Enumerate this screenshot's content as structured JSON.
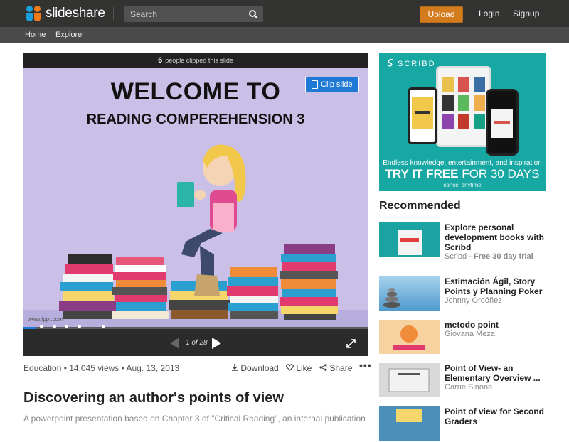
{
  "header": {
    "logo_text": "slideshare",
    "search_placeholder": "Search",
    "upload_label": "Upload",
    "login_label": "Login",
    "signup_label": "Signup"
  },
  "subnav": {
    "home": "Home",
    "explore": "Explore"
  },
  "player": {
    "clip_count": "6",
    "clip_text": "people clipped this slide",
    "clip_button": "Clip slide",
    "slide_title": "WELCOME TO",
    "slide_subtitle": "READING COMPEREHENSION 3",
    "slide_url": "www.fppt.com",
    "page_indicator": "1 of 28",
    "progress": 0.036
  },
  "meta": {
    "info": "Education • 14,045 views • Aug. 13, 2013",
    "download": "Download",
    "like": "Like",
    "share": "Share",
    "more": "•••"
  },
  "page_title": "Discovering an author's points of view",
  "description": "A powerpoint presentation based on Chapter 3 of \"Critical Reading\", an internal publication of",
  "ad": {
    "brand": "SCRIBD",
    "line1": "Endless knowledge, entertainment, and inspiration",
    "line2_bold": "TRY IT FREE",
    "line2_rest": " FOR 30 DAYS",
    "line3": "cancel anytime"
  },
  "recommended": {
    "heading": "Recommended",
    "items": [
      {
        "title": "Explore personal development books with Scribd",
        "author": "Scribd",
        "author_suffix": " - Free 30 day trial"
      },
      {
        "title": "Estimación Ágil, Story Points y Planning Poker",
        "author": "Johnny Ordóñez",
        "author_suffix": ""
      },
      {
        "title": "metodo point",
        "author": "Giovana Meza",
        "author_suffix": ""
      },
      {
        "title": "Point of View- an Elementary Overview ...",
        "author": "Carrie Sinone",
        "author_suffix": ""
      },
      {
        "title": "Point of view for Second Graders",
        "author": "",
        "author_suffix": ""
      }
    ]
  },
  "colors": {
    "accent": "#1e7ad4",
    "upload": "#d27c1e",
    "topbar": "#333332",
    "ad_teal": "#18a8a4"
  }
}
